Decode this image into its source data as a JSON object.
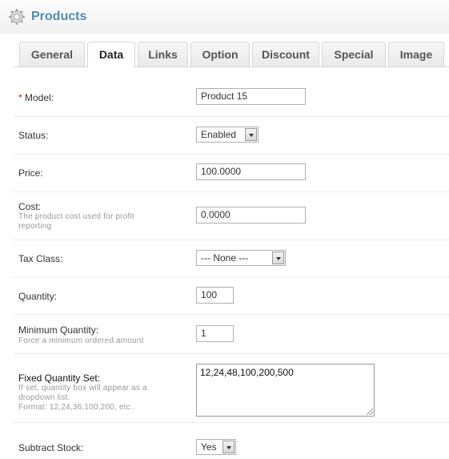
{
  "header": {
    "title": "Products",
    "icon": "gear-icon"
  },
  "tabs": [
    {
      "label": "General"
    },
    {
      "label": "Data",
      "active": true
    },
    {
      "label": "Links"
    },
    {
      "label": "Option"
    },
    {
      "label": "Discount"
    },
    {
      "label": "Special"
    },
    {
      "label": "Image"
    }
  ],
  "form": {
    "model": {
      "required_mark": "*",
      "label": "Model:",
      "value": "Product 15"
    },
    "status": {
      "label": "Status:",
      "value": "Enabled"
    },
    "price": {
      "label": "Price:",
      "value": "100.0000"
    },
    "cost": {
      "label": "Cost:",
      "help": "The product cost used for profit reporting",
      "value": "0.0000"
    },
    "tax_class": {
      "label": "Tax Class:",
      "value": "--- None ---"
    },
    "quantity": {
      "label": "Quantity:",
      "value": "100"
    },
    "minimum_quantity": {
      "label": "Minimum Quantity:",
      "help": "Force a minimum ordered amount",
      "value": "1"
    },
    "fixed_quantity_set": {
      "label": "Fixed Quantity Set:",
      "help_line1": "If set, quantity box will appear as a dropdown list.",
      "help_line2": "Format: 12,24,36,100,200, etc..",
      "value": "12,24,48,100,200,500"
    },
    "subtract_stock": {
      "label": "Subtract Stock:",
      "value": "Yes"
    }
  },
  "colors": {
    "title": "#4f8bb3",
    "required": "#ff0000",
    "help_text": "#999999"
  }
}
